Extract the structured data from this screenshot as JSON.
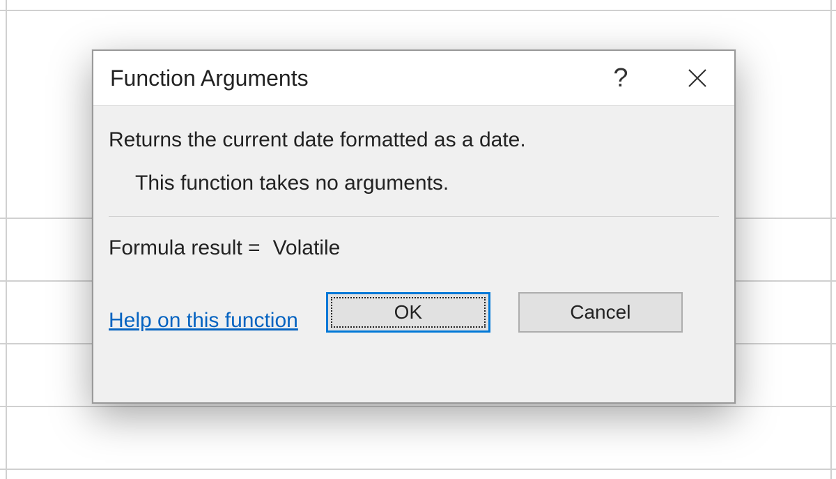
{
  "dialog": {
    "title": "Function Arguments",
    "help_icon": "?",
    "description": "Returns the current date formatted as a date.",
    "no_arguments_text": "This function takes no arguments.",
    "result_label": "Formula result =",
    "result_value": "Volatile",
    "help_link_text": "Help on this function",
    "ok_label": "OK",
    "cancel_label": "Cancel"
  }
}
